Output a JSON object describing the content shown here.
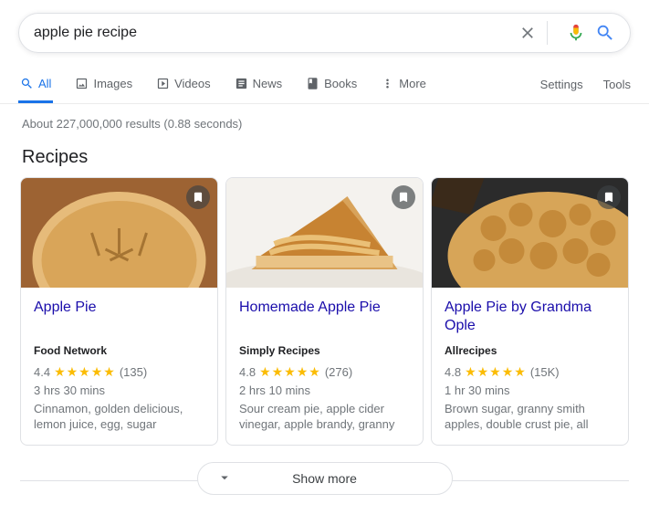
{
  "search": {
    "query": "apple pie recipe"
  },
  "tabs": {
    "all": "All",
    "images": "Images",
    "videos": "Videos",
    "news": "News",
    "books": "Books",
    "more": "More",
    "settings": "Settings",
    "tools": "Tools"
  },
  "result_stats": "About 227,000,000 results (0.88 seconds)",
  "section_heading": "Recipes",
  "recipes": [
    {
      "title": "Apple Pie",
      "source": "Food Network",
      "rating": "4.4",
      "stars": "★★★★★",
      "reviews": "(135)",
      "time": "3 hrs 30 mins",
      "ingredients": "Cinnamon, golden delicious, lemon juice, egg, sugar"
    },
    {
      "title": "Homemade Apple Pie",
      "source": "Simply Recipes",
      "rating": "4.8",
      "stars": "★★★★★",
      "reviews": "(276)",
      "time": "2 hrs 10 mins",
      "ingredients": "Sour cream pie, apple cider vinegar, apple brandy, granny"
    },
    {
      "title": "Apple Pie by Grandma Ople",
      "source": "Allrecipes",
      "rating": "4.8",
      "stars": "★★★★★",
      "reviews": "(15K)",
      "time": "1 hr 30 mins",
      "ingredients": "Brown sugar, granny smith apples, double crust pie, all"
    }
  ],
  "show_more": "Show more"
}
